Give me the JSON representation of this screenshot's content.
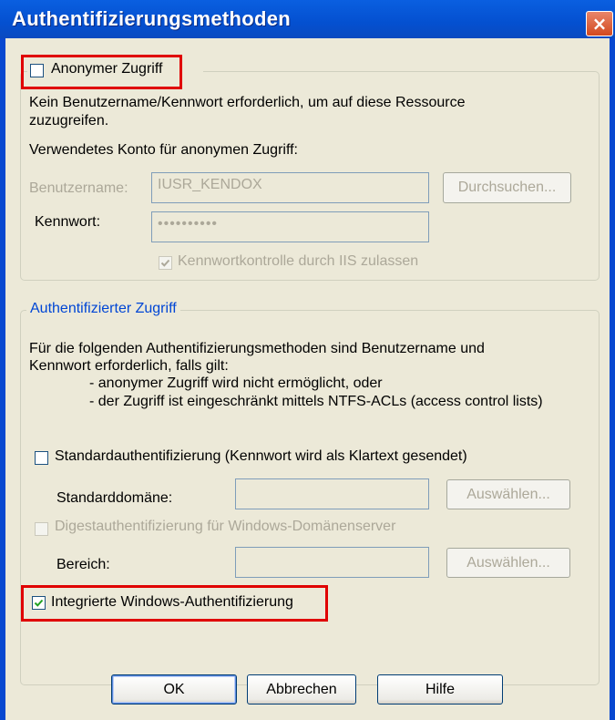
{
  "window": {
    "title": "Authentifizierungsmethoden",
    "close_icon": "×"
  },
  "anonymous": {
    "checkbox_label": "Anonymer Zugriff",
    "checked": false,
    "description": "Kein Benutzername/Kennwort erforderlich, um auf diese Ressource zuzugreifen.",
    "account_heading": "Verwendetes Konto für anonymen Zugriff:",
    "username_label": "Benutzername:",
    "username_value": "IUSR_KENDOX",
    "browse_button": "Durchsuchen...",
    "password_label": "Kennwort:",
    "password_value": "••••••••••",
    "iis_control_label": "Kennwortkontrolle durch IIS zulassen",
    "iis_control_checked": true
  },
  "authenticated": {
    "legend": "Authentifizierter Zugriff",
    "description_line1": "Für die folgenden Authentifizierungsmethoden sind Benutzername und",
    "description_line2": "Kennwort erforderlich, falls gilt:",
    "condition1": "- anonymer Zugriff wird nicht ermöglicht, oder",
    "condition2": "- der Zugriff ist eingeschränkt mittels NTFS-ACLs (access control lists)",
    "basic_label": "Standardauthentifizierung (Kennwort wird als Klartext gesendet)",
    "basic_checked": false,
    "default_domain_label": "Standarddomäne:",
    "default_domain_value": "",
    "select_button_1": "Auswählen...",
    "digest_label": "Digestauthentifizierung für Windows-Domänenserver",
    "digest_checked": false,
    "realm_label": "Bereich:",
    "realm_value": "",
    "select_button_2": "Auswählen...",
    "integrated_label": "Integrierte Windows-Authentifizierung",
    "integrated_checked": true
  },
  "buttons": {
    "ok": "OK",
    "cancel": "Abbrechen",
    "help": "Hilfe"
  },
  "colors": {
    "title_bar": "#0450d0",
    "dialog_bg": "#ece9d8",
    "highlight": "#e00000",
    "group_legend_blue": "#0046d5"
  }
}
